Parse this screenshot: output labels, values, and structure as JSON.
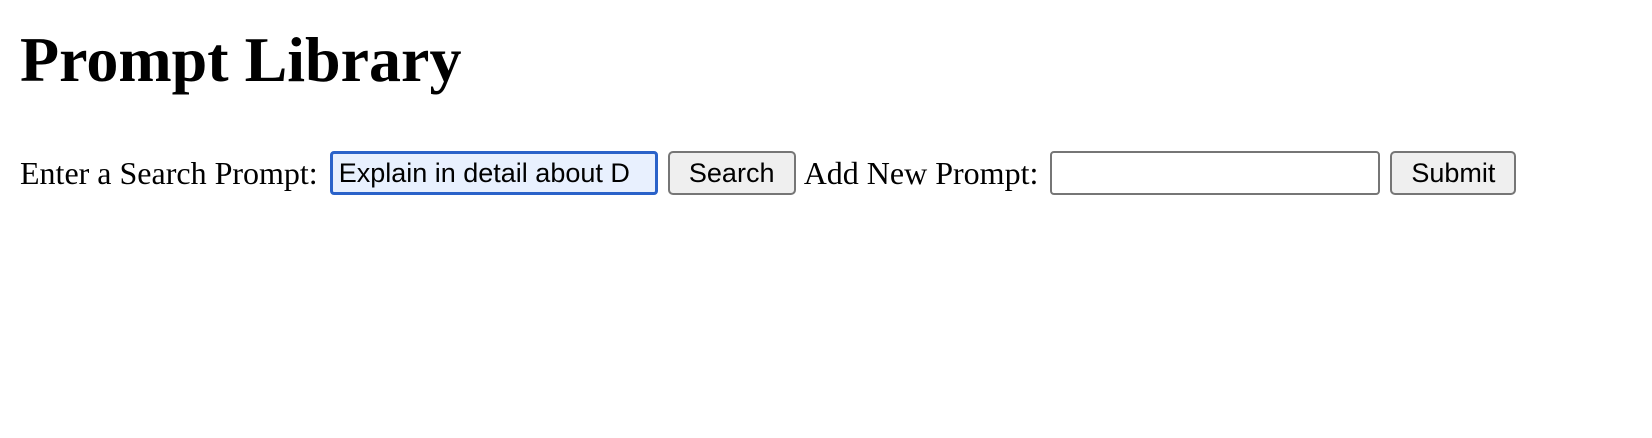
{
  "page": {
    "title": "Prompt Library"
  },
  "search": {
    "label": "Enter a Search Prompt:",
    "value": "Explain in detail about D",
    "button_label": "Search"
  },
  "add_prompt": {
    "label": "Add New Prompt:",
    "value": "",
    "button_label": "Submit"
  },
  "colors": {
    "focus_border": "#2a62c9",
    "focused_input_background": "#e8f0fe",
    "button_background": "#efefef"
  }
}
